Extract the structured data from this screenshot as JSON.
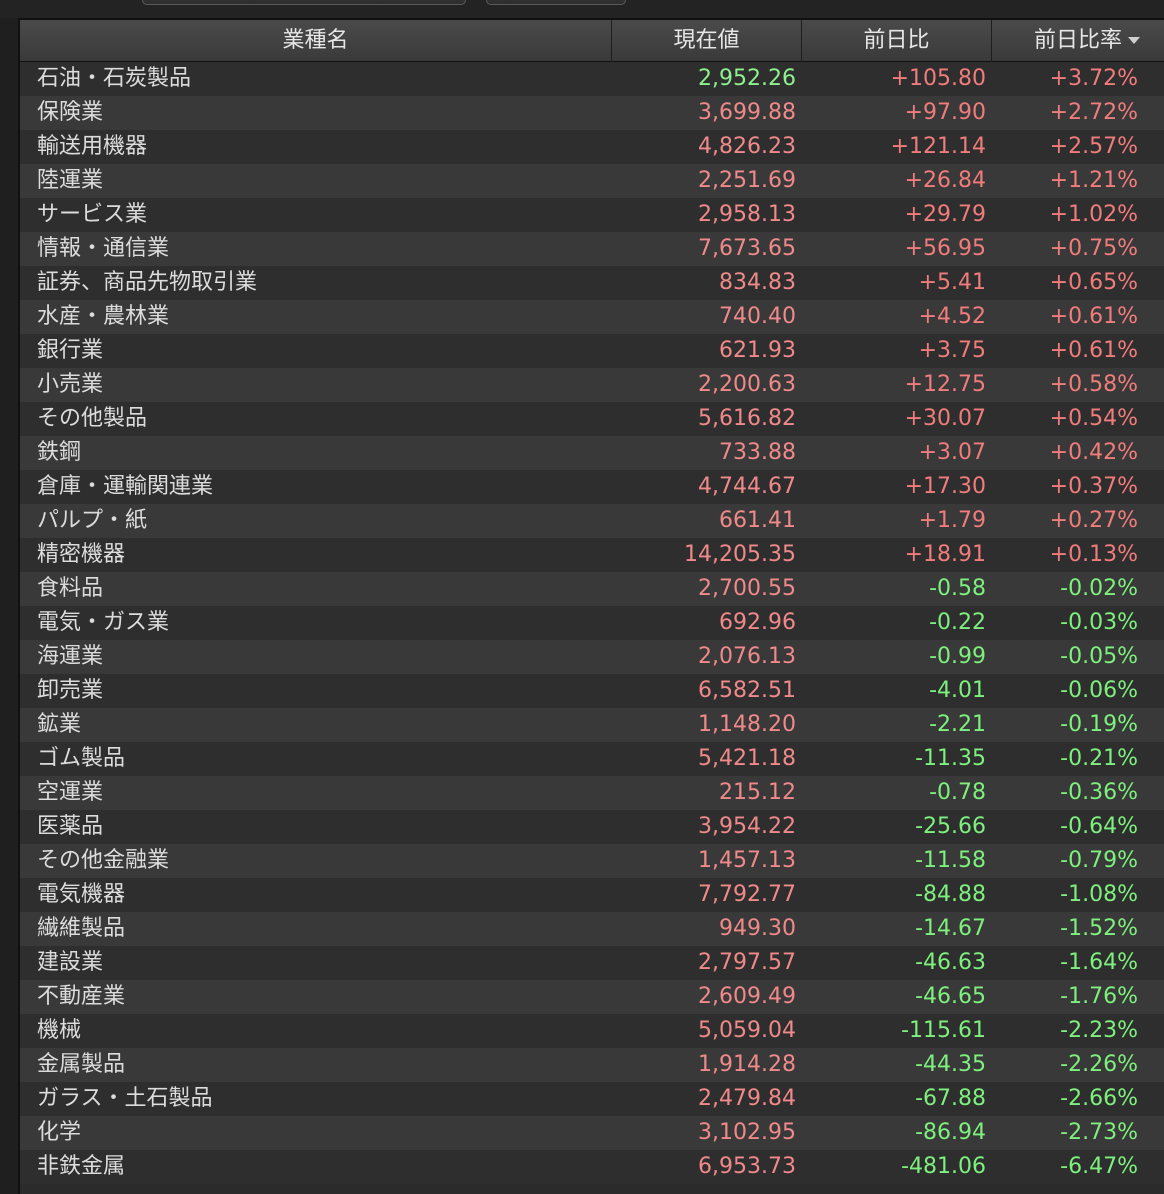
{
  "header": {
    "col_name": "業種名",
    "col_value": "現在値",
    "col_change": "前日比",
    "col_rate": "前日比率"
  },
  "colors": {
    "up": "#f07c7c",
    "down": "#7ef07e"
  },
  "rows": [
    {
      "name": "石油・石炭製品",
      "value": "2,952.26",
      "change": "+105.80",
      "rate": "+3.72%",
      "dir": "up",
      "value_green": true
    },
    {
      "name": "保険業",
      "value": "3,699.88",
      "change": "+97.90",
      "rate": "+2.72%",
      "dir": "up"
    },
    {
      "name": "輸送用機器",
      "value": "4,826.23",
      "change": "+121.14",
      "rate": "+2.57%",
      "dir": "up"
    },
    {
      "name": "陸運業",
      "value": "2,251.69",
      "change": "+26.84",
      "rate": "+1.21%",
      "dir": "up"
    },
    {
      "name": "サービス業",
      "value": "2,958.13",
      "change": "+29.79",
      "rate": "+1.02%",
      "dir": "up"
    },
    {
      "name": "情報・通信業",
      "value": "7,673.65",
      "change": "+56.95",
      "rate": "+0.75%",
      "dir": "up"
    },
    {
      "name": "証券、商品先物取引業",
      "value": "834.83",
      "change": "+5.41",
      "rate": "+0.65%",
      "dir": "up"
    },
    {
      "name": "水産・農林業",
      "value": "740.40",
      "change": "+4.52",
      "rate": "+0.61%",
      "dir": "up"
    },
    {
      "name": "銀行業",
      "value": "621.93",
      "change": "+3.75",
      "rate": "+0.61%",
      "dir": "up"
    },
    {
      "name": "小売業",
      "value": "2,200.63",
      "change": "+12.75",
      "rate": "+0.58%",
      "dir": "up"
    },
    {
      "name": "その他製品",
      "value": "5,616.82",
      "change": "+30.07",
      "rate": "+0.54%",
      "dir": "up"
    },
    {
      "name": "鉄鋼",
      "value": "733.88",
      "change": "+3.07",
      "rate": "+0.42%",
      "dir": "up"
    },
    {
      "name": "倉庫・運輸関連業",
      "value": "4,744.67",
      "change": "+17.30",
      "rate": "+0.37%",
      "dir": "up"
    },
    {
      "name": "パルプ・紙",
      "value": "661.41",
      "change": "+1.79",
      "rate": "+0.27%",
      "dir": "up"
    },
    {
      "name": "精密機器",
      "value": "14,205.35",
      "change": "+18.91",
      "rate": "+0.13%",
      "dir": "up"
    },
    {
      "name": "食料品",
      "value": "2,700.55",
      "change": "-0.58",
      "rate": "-0.02%",
      "dir": "down"
    },
    {
      "name": "電気・ガス業",
      "value": "692.96",
      "change": "-0.22",
      "rate": "-0.03%",
      "dir": "down"
    },
    {
      "name": "海運業",
      "value": "2,076.13",
      "change": "-0.99",
      "rate": "-0.05%",
      "dir": "down"
    },
    {
      "name": "卸売業",
      "value": "6,582.51",
      "change": "-4.01",
      "rate": "-0.06%",
      "dir": "down"
    },
    {
      "name": "鉱業",
      "value": "1,148.20",
      "change": "-2.21",
      "rate": "-0.19%",
      "dir": "down"
    },
    {
      "name": "ゴム製品",
      "value": "5,421.18",
      "change": "-11.35",
      "rate": "-0.21%",
      "dir": "down"
    },
    {
      "name": "空運業",
      "value": "215.12",
      "change": "-0.78",
      "rate": "-0.36%",
      "dir": "down"
    },
    {
      "name": "医薬品",
      "value": "3,954.22",
      "change": "-25.66",
      "rate": "-0.64%",
      "dir": "down"
    },
    {
      "name": "その他金融業",
      "value": "1,457.13",
      "change": "-11.58",
      "rate": "-0.79%",
      "dir": "down"
    },
    {
      "name": "電気機器",
      "value": "7,792.77",
      "change": "-84.88",
      "rate": "-1.08%",
      "dir": "down"
    },
    {
      "name": "繊維製品",
      "value": "949.30",
      "change": "-14.67",
      "rate": "-1.52%",
      "dir": "down"
    },
    {
      "name": "建設業",
      "value": "2,797.57",
      "change": "-46.63",
      "rate": "-1.64%",
      "dir": "down"
    },
    {
      "name": "不動産業",
      "value": "2,609.49",
      "change": "-46.65",
      "rate": "-1.76%",
      "dir": "down"
    },
    {
      "name": "機械",
      "value": "5,059.04",
      "change": "-115.61",
      "rate": "-2.23%",
      "dir": "down"
    },
    {
      "name": "金属製品",
      "value": "1,914.28",
      "change": "-44.35",
      "rate": "-2.26%",
      "dir": "down"
    },
    {
      "name": "ガラス・土石製品",
      "value": "2,479.84",
      "change": "-67.88",
      "rate": "-2.66%",
      "dir": "down"
    },
    {
      "name": "化学",
      "value": "3,102.95",
      "change": "-86.94",
      "rate": "-2.73%",
      "dir": "down"
    },
    {
      "name": "非鉄金属",
      "value": "6,953.73",
      "change": "-481.06",
      "rate": "-6.47%",
      "dir": "down"
    }
  ]
}
